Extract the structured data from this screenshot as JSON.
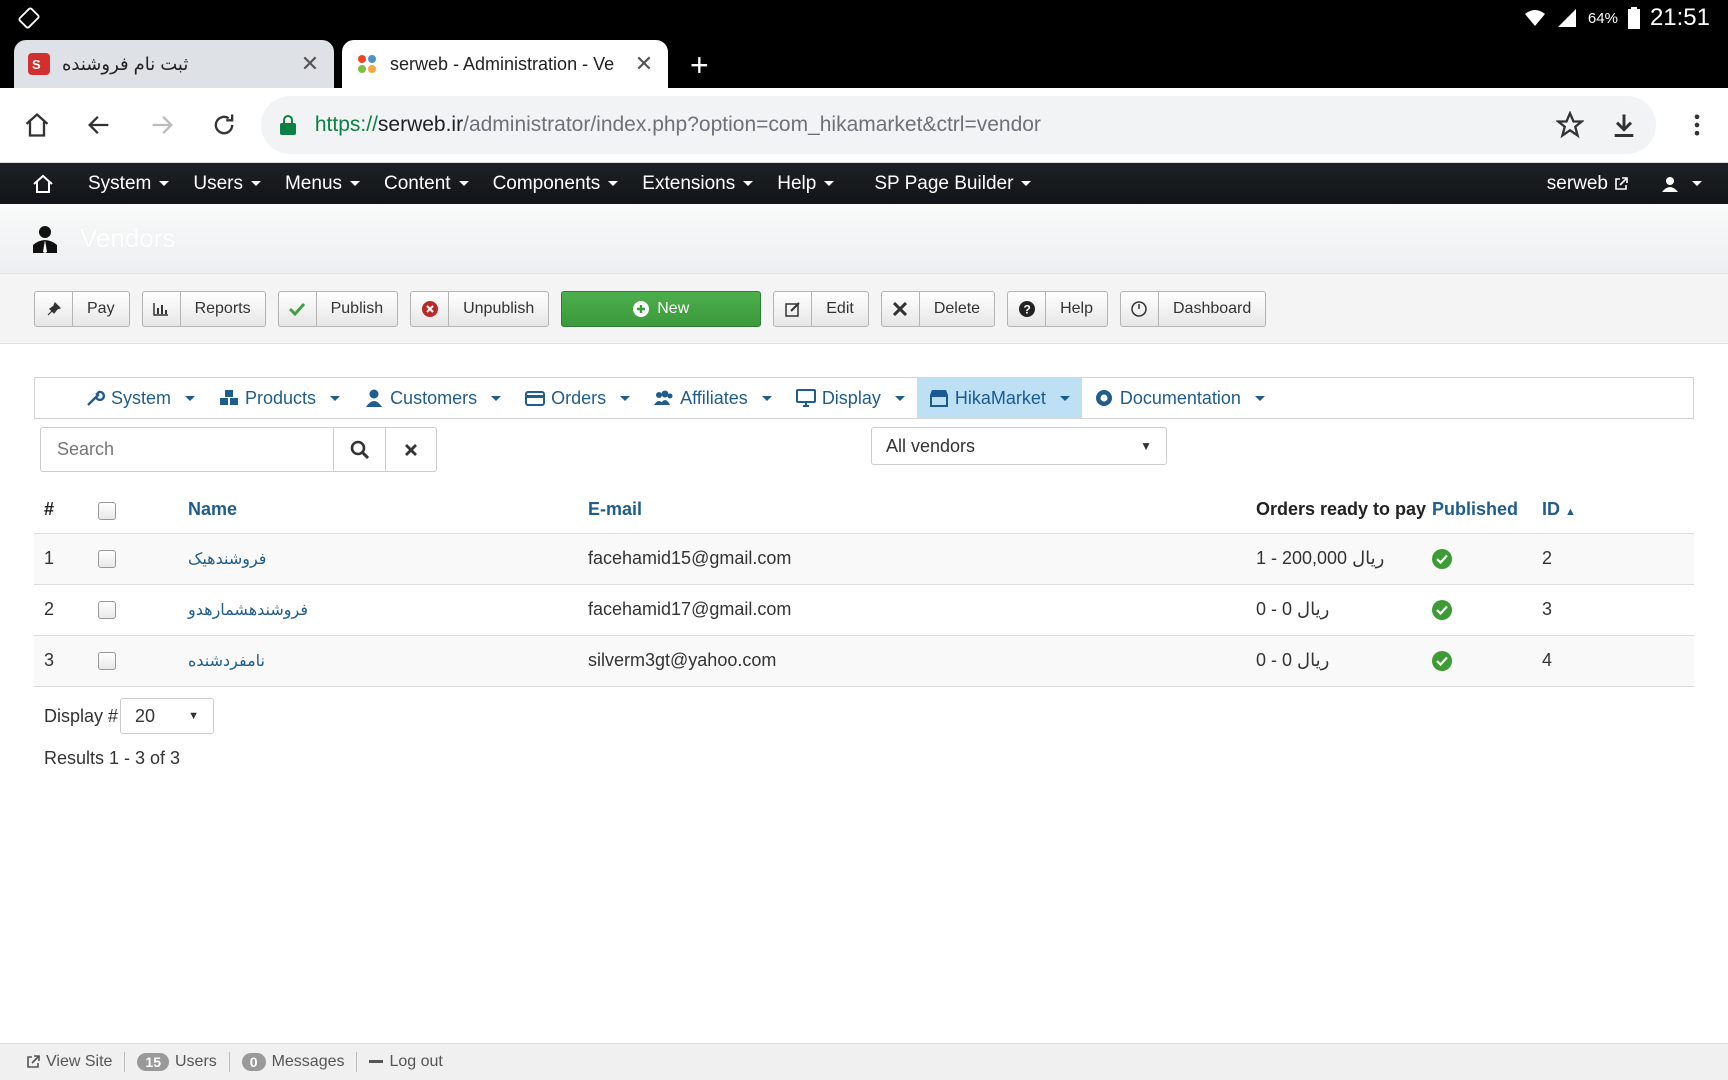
{
  "status_bar": {
    "battery": "64%",
    "time": "21:51"
  },
  "browser": {
    "tabs": [
      {
        "title": "ثبت نام فروشنده",
        "active": false
      },
      {
        "title": "serweb - Administration - Ve",
        "active": true
      }
    ],
    "url": {
      "scheme": "https://",
      "host": "serweb.ir",
      "path": "/administrator/index.php?option=com_hikamarket&ctrl=vendor"
    }
  },
  "admin_menu": {
    "items": [
      "System",
      "Users",
      "Menus",
      "Content",
      "Components",
      "Extensions",
      "Help",
      "SP Page Builder"
    ],
    "site_name": "serweb"
  },
  "page_title": "Vendors",
  "toolbar": {
    "pay": "Pay",
    "reports": "Reports",
    "publish": "Publish",
    "unpublish": "Unpublish",
    "new": "New",
    "edit": "Edit",
    "delete": "Delete",
    "help": "Help",
    "dashboard": "Dashboard"
  },
  "submenu": {
    "items": [
      "System",
      "Products",
      "Customers",
      "Orders",
      "Affiliates",
      "Display",
      "HikaMarket",
      "Documentation"
    ],
    "active": "HikaMarket"
  },
  "filters": {
    "search_placeholder": "Search",
    "vendor_filter": "All vendors"
  },
  "table": {
    "headers": {
      "num": "#",
      "name": "Name",
      "email": "E-mail",
      "orders": "Orders ready to pay",
      "published": "Published",
      "id": "ID"
    },
    "rows": [
      {
        "num": "1",
        "name": "فروشندهیک",
        "email": "facehamid15@gmail.com",
        "orders": "1 - 200,000 ریال",
        "id": "2"
      },
      {
        "num": "2",
        "name": "فروشندهشمارهدو",
        "email": "facehamid17@gmail.com",
        "orders": "0 - 0 ریال",
        "id": "3"
      },
      {
        "num": "3",
        "name": "نامفردشنده",
        "email": "silverm3gt@yahoo.com",
        "orders": "0 - 0 ریال",
        "id": "4"
      }
    ]
  },
  "pagination": {
    "display_label": "Display #",
    "limit": "20",
    "results": "Results 1 - 3 of 3"
  },
  "footer": {
    "view_site": "View Site",
    "users_count": "15",
    "users_label": "Users",
    "messages_count": "0",
    "messages_label": "Messages",
    "logout": "Log out"
  },
  "colors": {
    "accent_green": "#43a047",
    "link_blue": "#1f5d8c",
    "active_submenu": "#bde0f5"
  }
}
